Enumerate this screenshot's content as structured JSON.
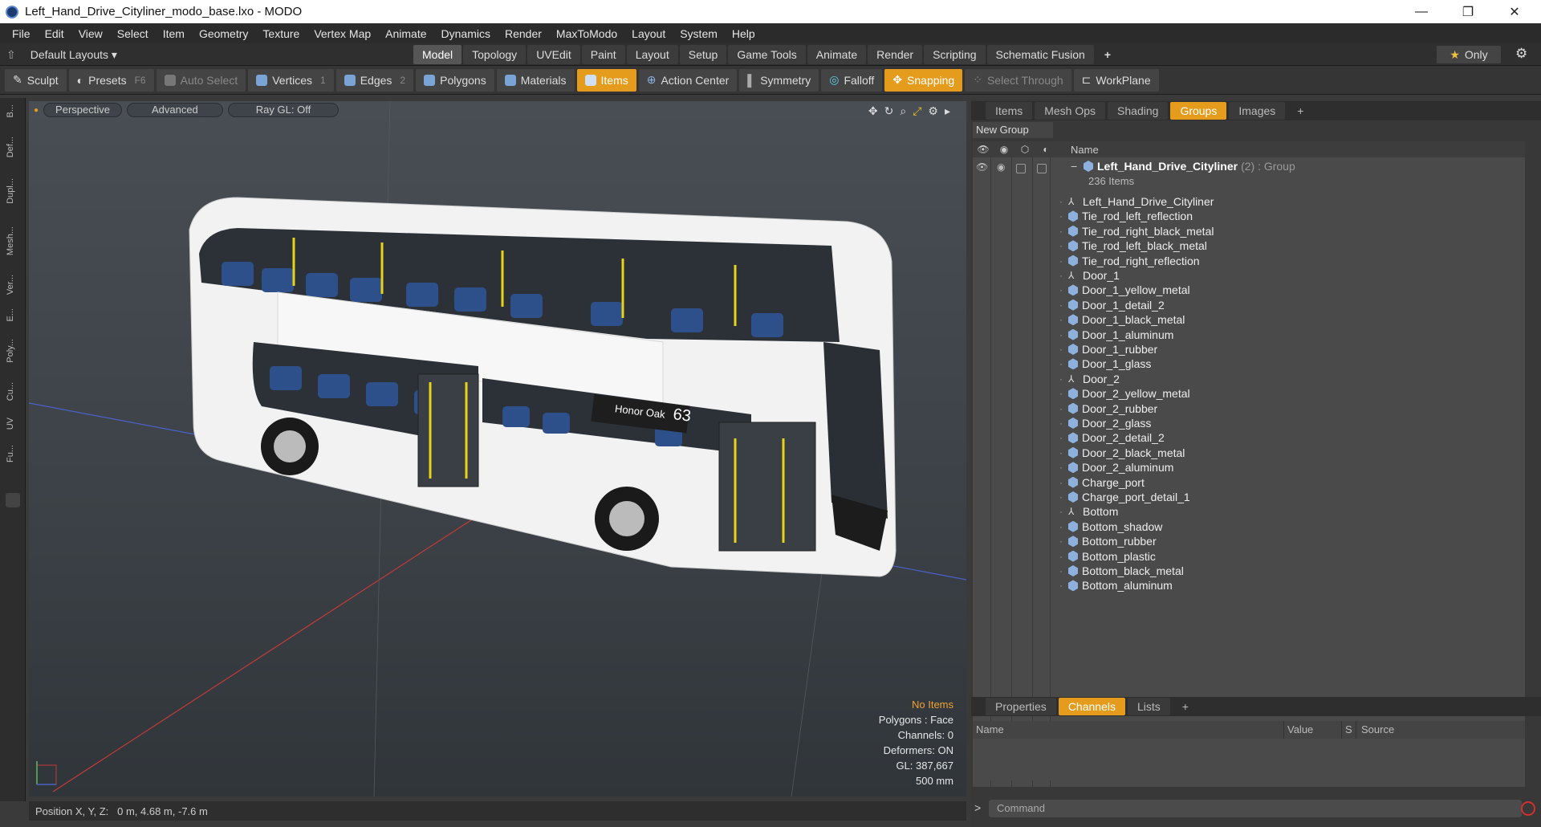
{
  "window": {
    "title": "Left_Hand_Drive_Cityliner_modo_base.lxo - MODO",
    "min": "—",
    "max": "❐",
    "close": "✕"
  },
  "menu": [
    "File",
    "Edit",
    "View",
    "Select",
    "Item",
    "Geometry",
    "Texture",
    "Vertex Map",
    "Animate",
    "Dynamics",
    "Render",
    "MaxToModo",
    "Layout",
    "System",
    "Help"
  ],
  "layouts": "Default Layouts ▾",
  "mode_tabs": [
    "Model",
    "Topology",
    "UVEdit",
    "Paint",
    "Layout",
    "Setup",
    "Game Tools",
    "Animate",
    "Render",
    "Scripting",
    "Schematic Fusion",
    "+"
  ],
  "only": "Only",
  "toolbar": {
    "sculpt": "Sculpt",
    "presets": "Presets",
    "presets_key": "F6",
    "autoselect": "Auto Select",
    "vertices": "Vertices",
    "vertices_key": "1",
    "edges": "Edges",
    "edges_key": "2",
    "polygons": "Polygons",
    "materials": "Materials",
    "items": "Items",
    "action_center": "Action Center",
    "symmetry": "Symmetry",
    "falloff": "Falloff",
    "snapping": "Snapping",
    "select_through": "Select Through",
    "workplane": "WorkPlane"
  },
  "left_tabs": [
    "B...",
    "Def...",
    "Dupl...",
    "Mesh...",
    "Ver...",
    "E...",
    "Poly...",
    "Cu...",
    "UV",
    "Fu..."
  ],
  "viewport": {
    "perspective": "Perspective",
    "advanced": "Advanced",
    "raygl": "Ray GL: Off",
    "bus_sign": "Honor Oak",
    "bus_num": "63",
    "stats": {
      "noitems": "No Items",
      "polygons": "Polygons : Face",
      "channels": "Channels: 0",
      "deformers": "Deformers: ON",
      "gl": "GL: 387,667",
      "scale": "500 mm"
    }
  },
  "status": "Position X, Y, Z:   0 m, 4.68 m, -7.6 m",
  "right_tabs": [
    "Items",
    "Mesh Ops",
    "Shading",
    "Groups",
    "Images",
    "+"
  ],
  "new_group": "New Group",
  "tree_header": "Name",
  "group": {
    "name": "Left_Hand_Drive_Cityliner",
    "meta": "(2) : Group",
    "count": "236 Items"
  },
  "tree_items": [
    {
      "name": "Left_Hand_Drive_Cityliner",
      "kind": "locator"
    },
    {
      "name": "Tie_rod_left_reflection",
      "kind": "mesh"
    },
    {
      "name": "Tie_rod_right_black_metal",
      "kind": "mesh"
    },
    {
      "name": "Tie_rod_left_black_metal",
      "kind": "mesh"
    },
    {
      "name": "Tie_rod_right_reflection",
      "kind": "mesh"
    },
    {
      "name": "Door_1",
      "kind": "locator"
    },
    {
      "name": "Door_1_yellow_metal",
      "kind": "mesh"
    },
    {
      "name": "Door_1_detail_2",
      "kind": "mesh"
    },
    {
      "name": "Door_1_black_metal",
      "kind": "mesh"
    },
    {
      "name": "Door_1_aluminum",
      "kind": "mesh"
    },
    {
      "name": "Door_1_rubber",
      "kind": "mesh"
    },
    {
      "name": "Door_1_glass",
      "kind": "mesh"
    },
    {
      "name": "Door_2",
      "kind": "locator"
    },
    {
      "name": "Door_2_yellow_metal",
      "kind": "mesh"
    },
    {
      "name": "Door_2_rubber",
      "kind": "mesh"
    },
    {
      "name": "Door_2_glass",
      "kind": "mesh"
    },
    {
      "name": "Door_2_detail_2",
      "kind": "mesh"
    },
    {
      "name": "Door_2_black_metal",
      "kind": "mesh"
    },
    {
      "name": "Door_2_aluminum",
      "kind": "mesh"
    },
    {
      "name": "Charge_port",
      "kind": "mesh"
    },
    {
      "name": "Charge_port_detail_1",
      "kind": "mesh"
    },
    {
      "name": "Bottom",
      "kind": "locator"
    },
    {
      "name": "Bottom_shadow",
      "kind": "mesh"
    },
    {
      "name": "Bottom_rubber",
      "kind": "mesh"
    },
    {
      "name": "Bottom_plastic",
      "kind": "mesh"
    },
    {
      "name": "Bottom_black_metal",
      "kind": "mesh"
    },
    {
      "name": "Bottom_aluminum",
      "kind": "mesh"
    }
  ],
  "lower_tabs": [
    "Properties",
    "Channels",
    "Lists",
    "+"
  ],
  "channel_cols": [
    "Name",
    "Value",
    "S",
    "Source"
  ],
  "command_placeholder": "Command"
}
